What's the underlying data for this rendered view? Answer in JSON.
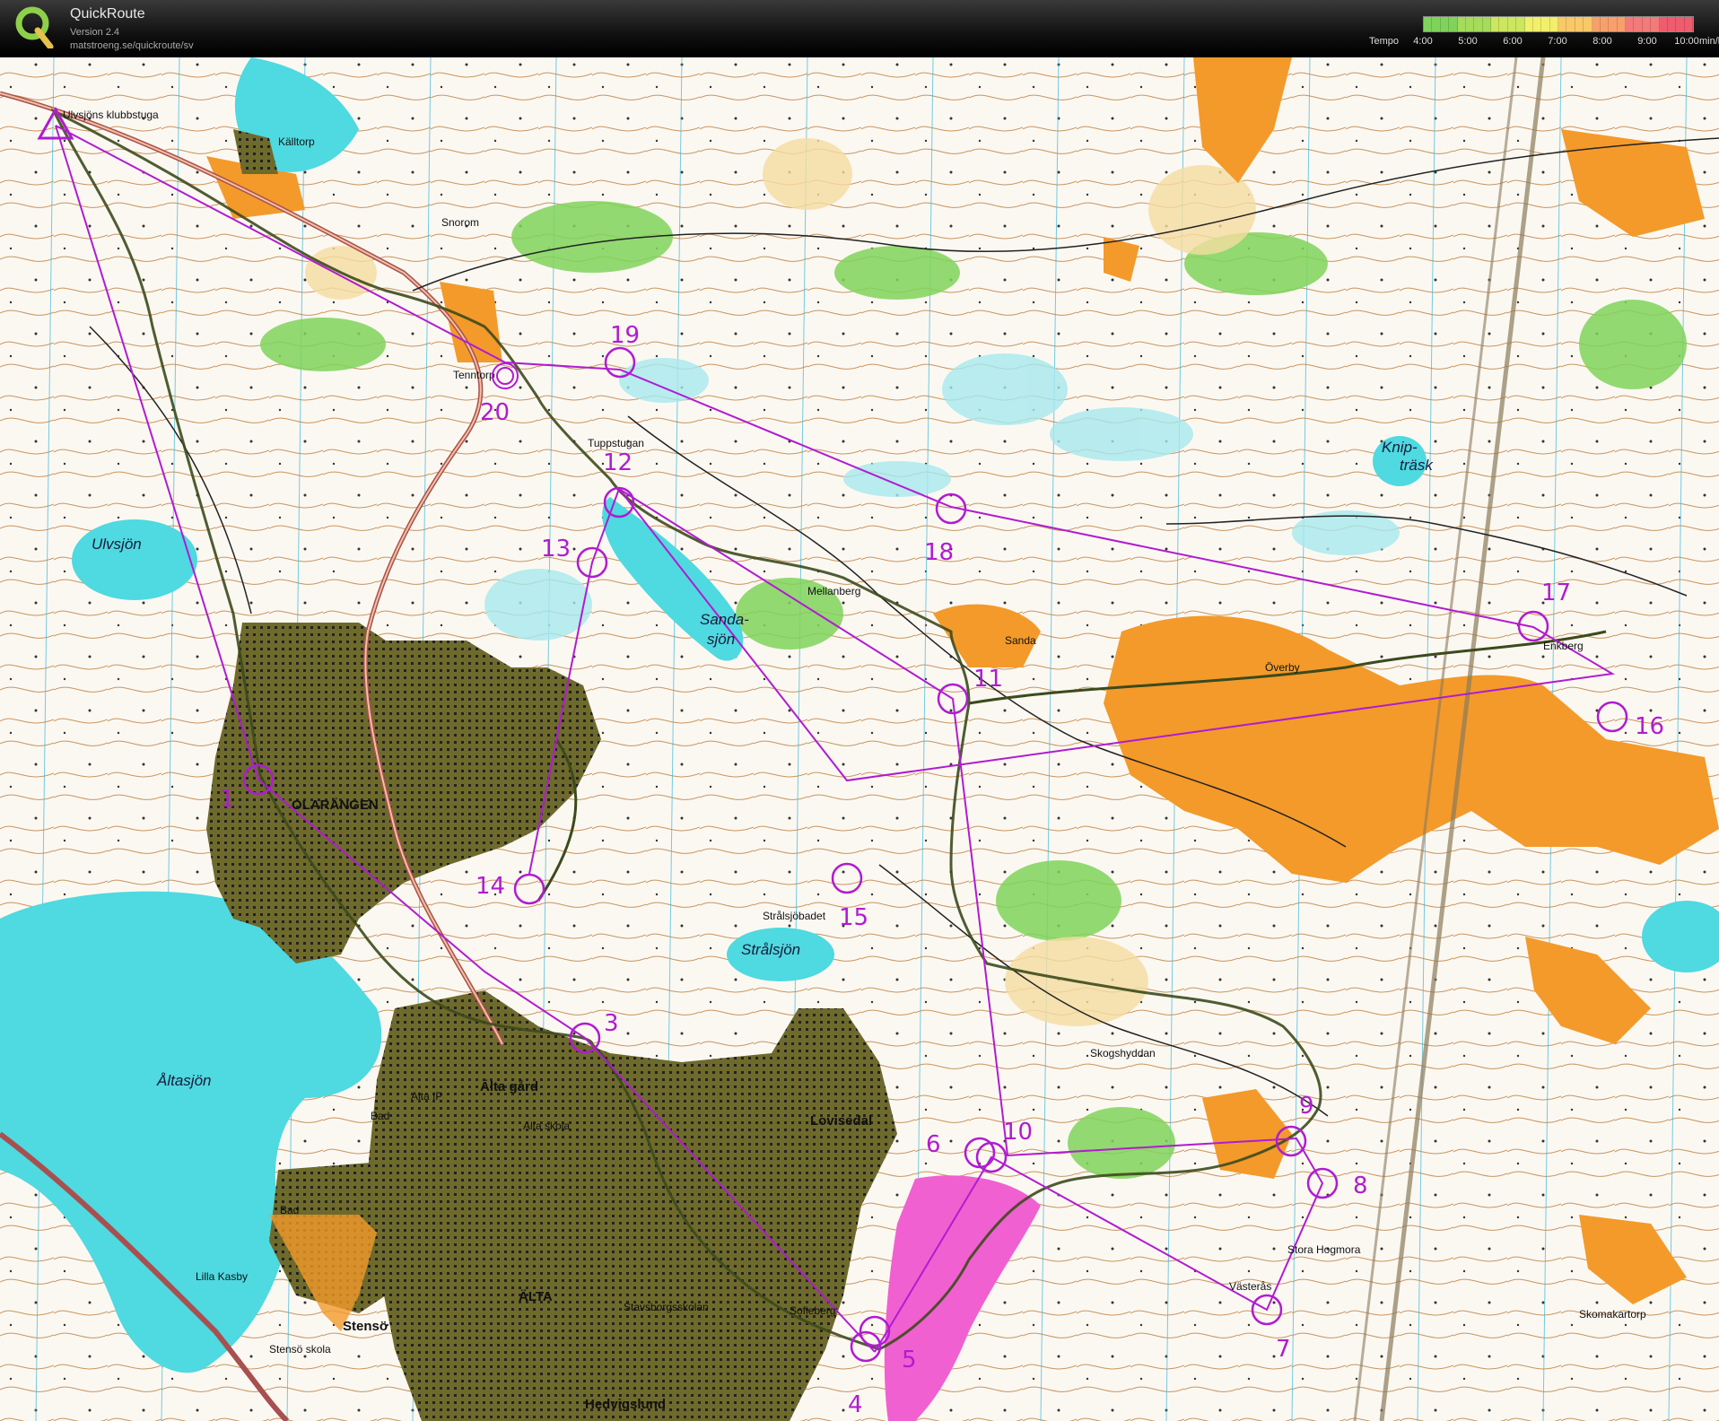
{
  "app": {
    "name": "QuickRoute",
    "version": "Version 2.4",
    "url": "matstroeng.se/quickroute/sv"
  },
  "legend": {
    "title": "Tempo",
    "ticks": [
      "4:00",
      "5:00",
      "6:00",
      "7:00",
      "8:00",
      "9:00",
      "10:00"
    ],
    "unit": "min/km",
    "gradient_colors": [
      "#7fd35a",
      "#a6dc5c",
      "#cde660",
      "#f2f06a",
      "#f9c868",
      "#f7a06c",
      "#f27a78",
      "#ee5c6e"
    ]
  },
  "colors": {
    "course": "#b01cd0",
    "route": "#3c4a1c",
    "water": "#4fd9e0",
    "urban": "#6e6a2c",
    "open": "#f39a2b",
    "green": "#7fd35a",
    "special": "#f060d0"
  },
  "controls": [
    {
      "label": "1"
    },
    {
      "label": "3"
    },
    {
      "label": "4"
    },
    {
      "label": "5"
    },
    {
      "label": "6"
    },
    {
      "label": "7"
    },
    {
      "label": "8"
    },
    {
      "label": "9"
    },
    {
      "label": "10"
    },
    {
      "label": "11"
    },
    {
      "label": "12"
    },
    {
      "label": "13"
    },
    {
      "label": "14"
    },
    {
      "label": "15"
    },
    {
      "label": "16"
    },
    {
      "label": "17"
    },
    {
      "label": "18"
    },
    {
      "label": "19"
    },
    {
      "label": "20"
    }
  ],
  "places": [
    "Källtorp",
    "Snorom",
    "Tenntorp",
    "Tuppstugan",
    "Mellanberg",
    "Sanda",
    "Överby",
    "Enkberg",
    "Strålsjöbadet",
    "Skogshyddan",
    "Västerås",
    "Stora Hogmora",
    "Skomakartorp",
    "Bad",
    "Bad",
    "Lilla Kasby",
    "Alta IP",
    "Alta skola",
    "Stensö skola",
    "Hedvigslund",
    "Alta gård",
    "Lovisedal",
    "Stavsborgsskolan",
    "Sofieberg",
    "Stensö",
    "Ulvsjöns klubbstuga"
  ],
  "lakes": [
    "Ulvsjön",
    "Sanda-",
    "sjön",
    "Strålsjön",
    "Åltasjön",
    "Knip-",
    "träsk"
  ],
  "areas": [
    "OLARÄNGEN",
    "Älta gård",
    "Lovisedal",
    "ÄLTA",
    "Stensö",
    "Hedvigslund"
  ]
}
